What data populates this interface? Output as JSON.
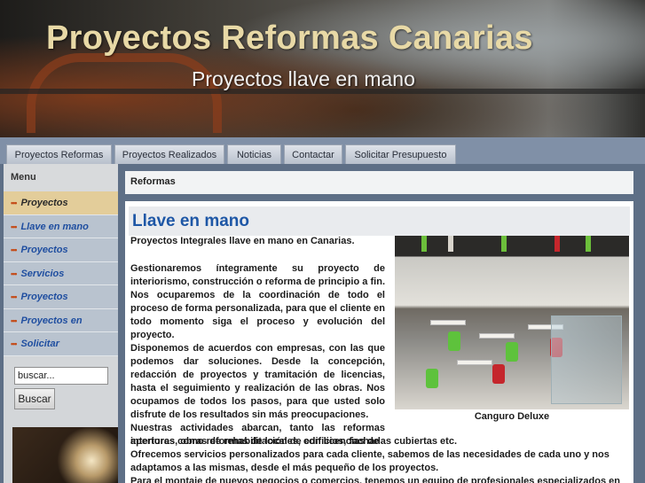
{
  "header": {
    "title": "Proyectos Reformas Canarias",
    "subtitle": "Proyectos llave en mano"
  },
  "nav": {
    "tabs": [
      "Proyectos Reformas",
      "Proyectos Realizados",
      "Noticias",
      "Contactar",
      "Solicitar Presupuesto"
    ]
  },
  "sidebar": {
    "heading": "Menu",
    "items": [
      "Proyectos",
      "Llave en mano",
      "Proyectos",
      "Servicios",
      "Proyectos",
      "Proyectos en",
      "Solicitar"
    ],
    "active_index": 0,
    "search_value": "buscar...",
    "search_button": "Buscar"
  },
  "main": {
    "breadcrumb": "Reformas",
    "heading": "Llave en mano",
    "lead": "Proyectos Integrales llave en mano en Canarias.",
    "paragraphs": [
      "Gestionaremos íntegramente su proyecto de interiorismo, construcción o reforma de principio a fin. Nos ocuparemos de la coordinación de todo el proceso de forma personalizada, para que el cliente en todo momento siga el proceso y evolución del proyecto.",
      "Disponemos de acuerdos con empresas, con las que podemos dar soluciones. Desde la concepción, redacción de proyectos y tramitación de licencias, hasta el seguimiento y realización de las obras. Nos ocupamos de todos los pasos, para que usted solo disfrute de los resultados sin más preocupaciones.",
      "Nuestras actividades abarcan, tanto las reformas interiores como reformas de locales, con licencias de"
    ],
    "wide_lines": [
      "aperturas, obras de rehabilitación de edificios, fachadas cubiertas etc.",
      "Ofrecemos servicios personalizados para cada cliente, sabemos de las necesidades de cada uno  y nos adaptamos a las mismas, desde el más pequeño de los proyectos.",
      "Para el montaje de nuevos negocios o comercios, tenemos un equipo de profesionales especializados en su"
    ],
    "image_caption": "Canguro Deluxe"
  },
  "colors": {
    "accent_link": "#1f4ea0",
    "heading_blue": "#1e57a6",
    "title_gold": "#e8d9a6",
    "bullet_orange": "#c44a16",
    "active_item": "#e3cd9a"
  }
}
